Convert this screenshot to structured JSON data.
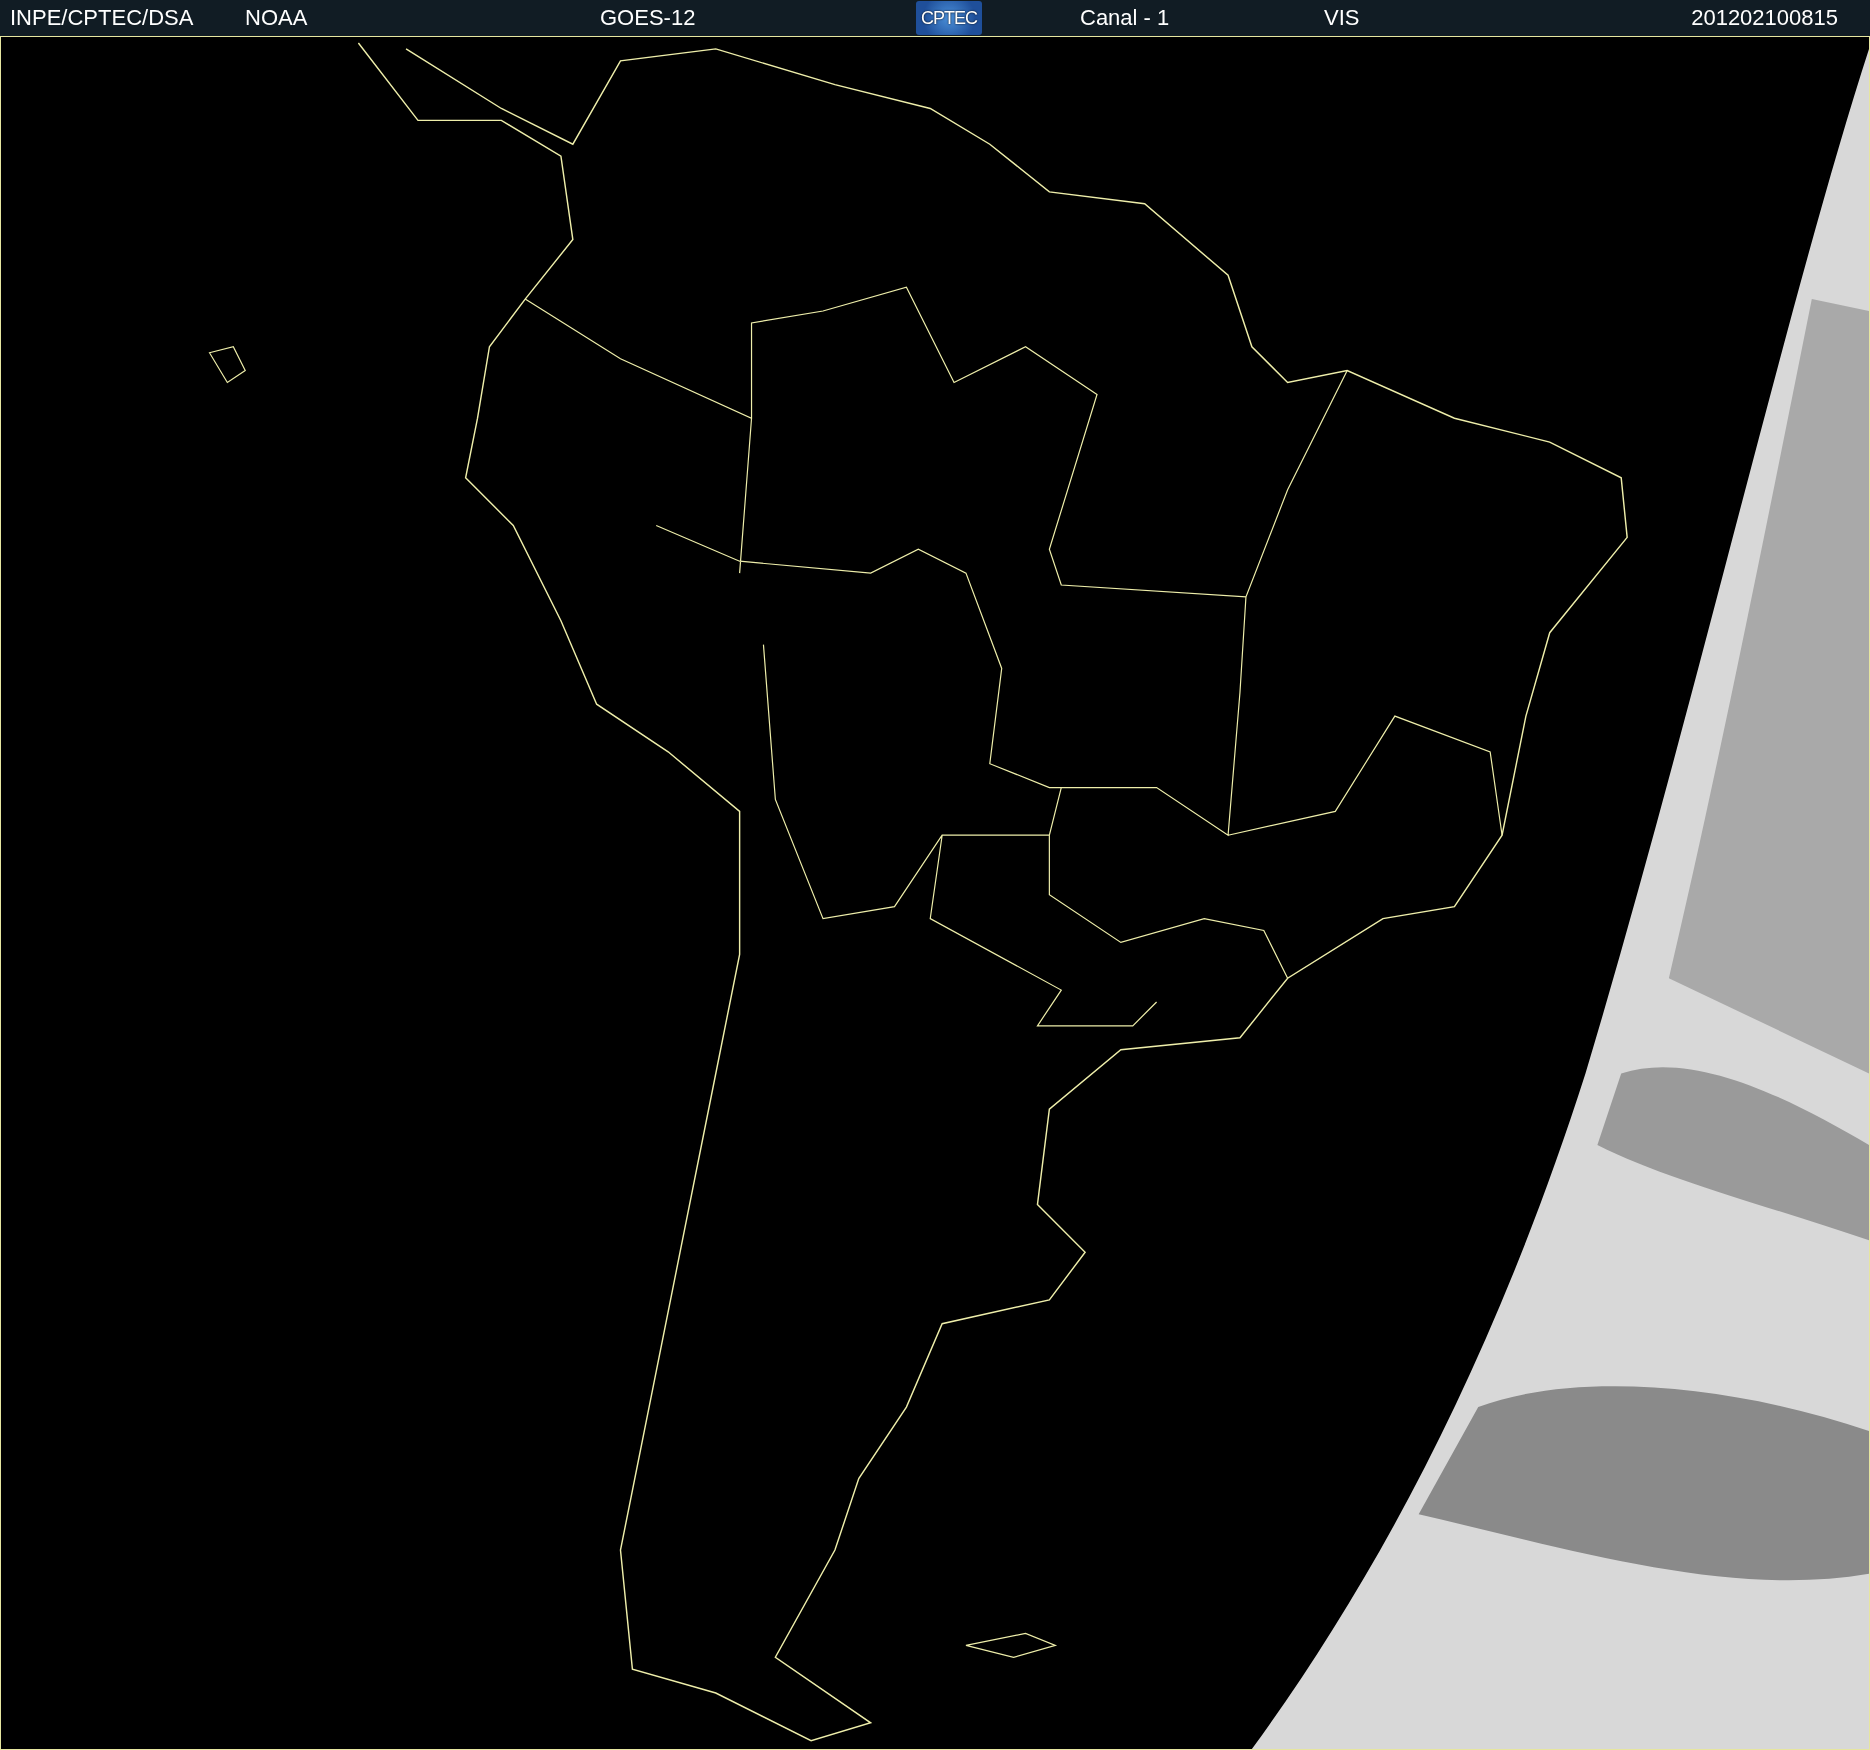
{
  "header": {
    "items": [
      {
        "kind": "text",
        "label": "INPE/CPTEC/DSA"
      },
      {
        "kind": "text",
        "label": "NOAA"
      },
      {
        "kind": "text",
        "label": "GOES-12"
      },
      {
        "kind": "logo",
        "label": "CPTEC"
      },
      {
        "kind": "text",
        "label": "Canal - 1"
      },
      {
        "kind": "text",
        "label": "VIS"
      },
      {
        "kind": "text",
        "label": "201202100815"
      }
    ]
  }
}
